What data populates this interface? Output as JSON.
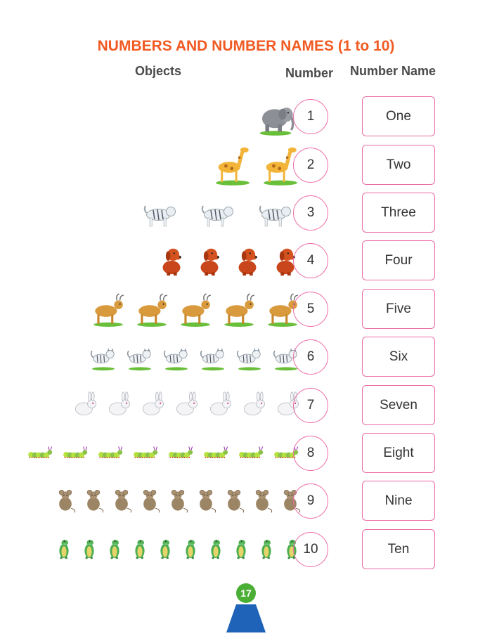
{
  "title": "NUMBERS AND NUMBER NAMES (1 to 10)",
  "headers": {
    "objects": "Objects",
    "number": "Number",
    "number_name": "Number Name"
  },
  "rows": [
    {
      "count": 1,
      "number": "1",
      "name": "One",
      "object_icon": "elephant-icon"
    },
    {
      "count": 2,
      "number": "2",
      "name": "Two",
      "object_icon": "giraffe-icon"
    },
    {
      "count": 3,
      "number": "3",
      "name": "Three",
      "object_icon": "tiger-icon"
    },
    {
      "count": 4,
      "number": "4",
      "name": "Four",
      "object_icon": "dog-icon"
    },
    {
      "count": 5,
      "number": "5",
      "name": "Five",
      "object_icon": "goat-icon"
    },
    {
      "count": 6,
      "number": "6",
      "name": "Six",
      "object_icon": "cat-icon"
    },
    {
      "count": 7,
      "number": "7",
      "name": "Seven",
      "object_icon": "rabbit-icon"
    },
    {
      "count": 8,
      "number": "8",
      "name": "Eight",
      "object_icon": "caterpillar-icon"
    },
    {
      "count": 9,
      "number": "9",
      "name": "Nine",
      "object_icon": "mouse-icon"
    },
    {
      "count": 10,
      "number": "10",
      "name": "Ten",
      "object_icon": "crocodile-icon"
    }
  ],
  "page_number": "17",
  "colors": {
    "title": "#f15a22",
    "border": "#ec6aa6",
    "page_badge": "#4caf35",
    "page_mountain": "#1e63b8"
  }
}
